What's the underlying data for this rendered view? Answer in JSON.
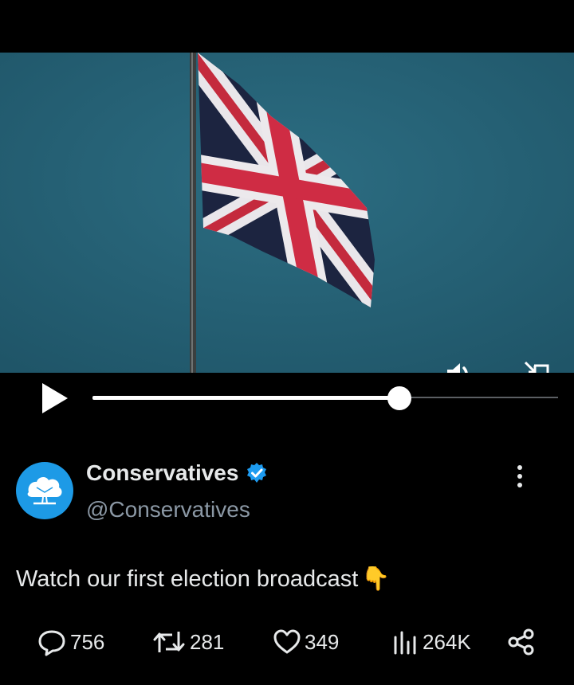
{
  "video": {
    "mute_icon": "speaker-icon",
    "pip_icon": "picture-in-picture-icon",
    "play_icon": "play-icon",
    "progress_fraction": 0.66
  },
  "author": {
    "name": "Conservatives",
    "handle": "@Conservatives",
    "verified": true,
    "avatar_color": "#1d9ae6",
    "verified_color": "#1d9bf0"
  },
  "tweet": {
    "text": "Watch our first election broadcast",
    "emoji": "👇"
  },
  "stats": {
    "replies": "756",
    "reposts": "281",
    "likes": "349",
    "views": "264K"
  }
}
